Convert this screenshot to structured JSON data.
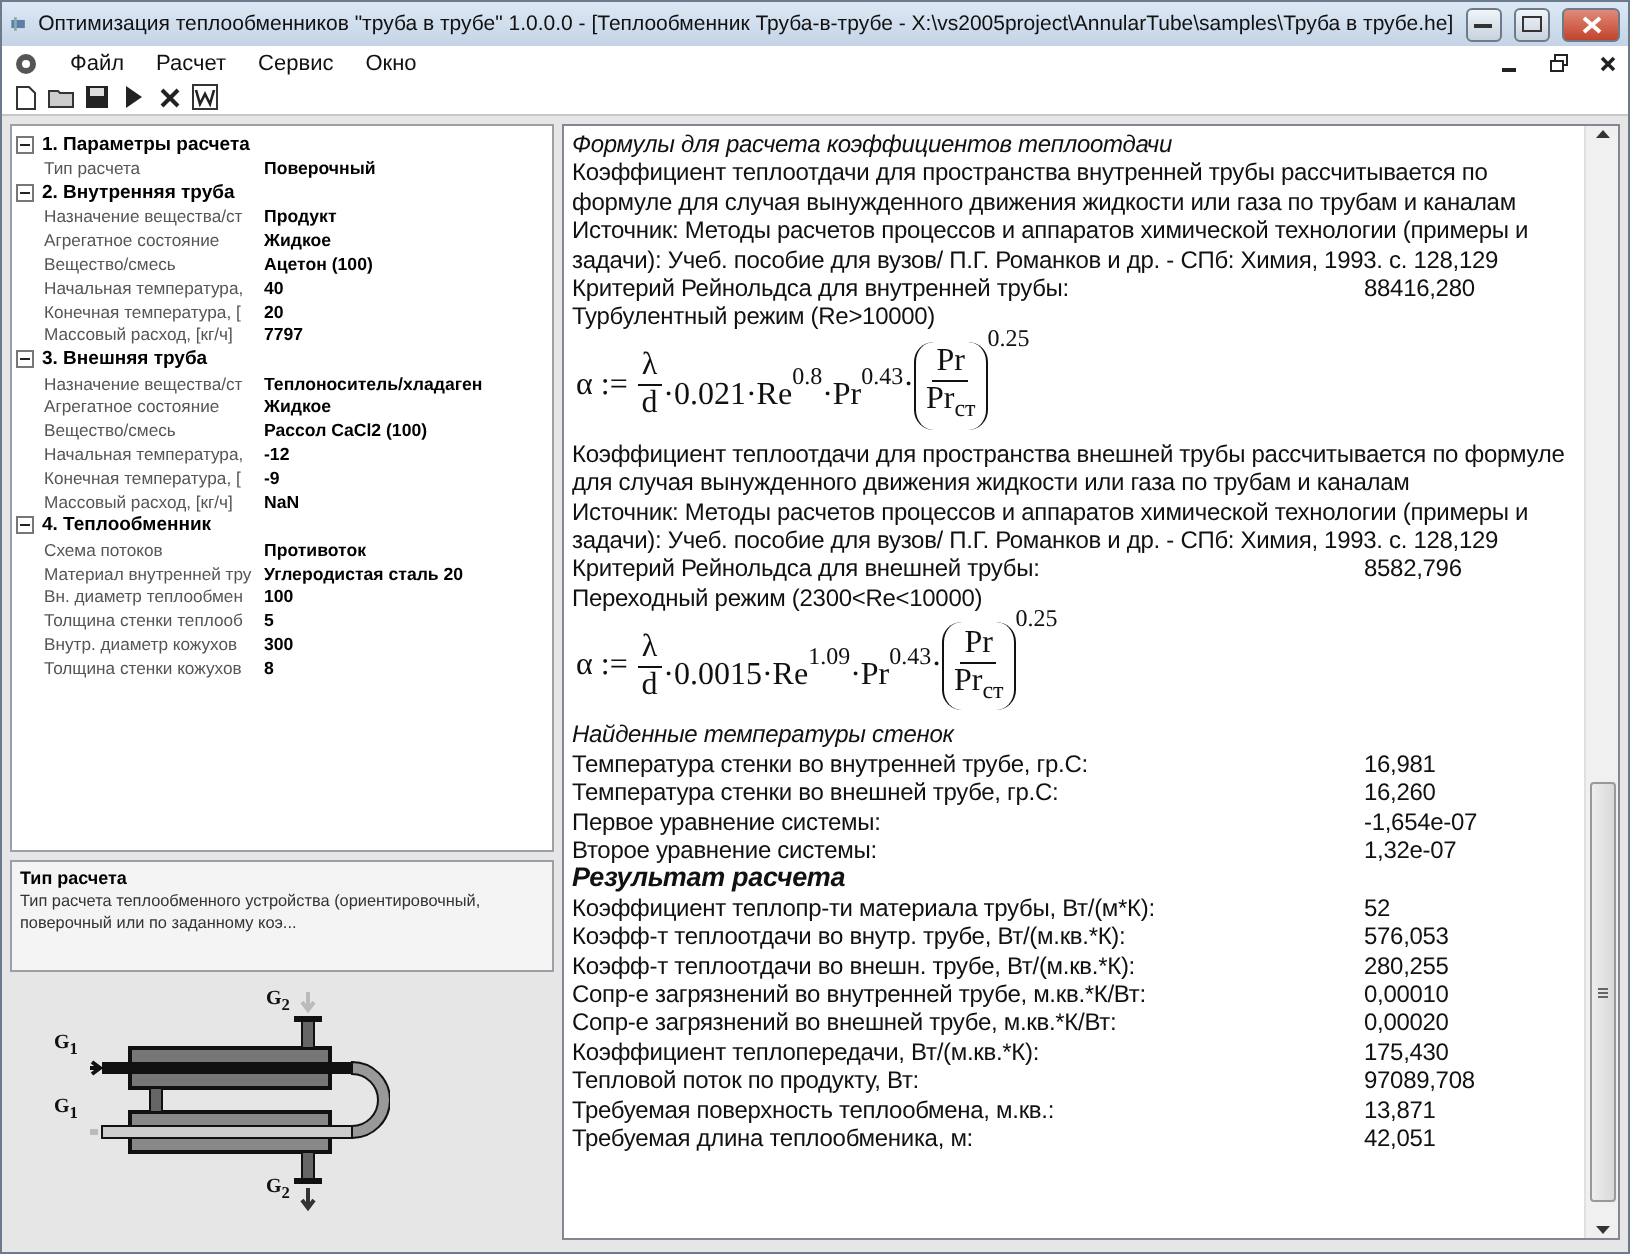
{
  "window": {
    "title": "Оптимизация теплообменников \"труба в трубе\" 1.0.0.0 - [Теплообменник Труба-в-трубе - X:\\vs2005project\\AnnularTube\\samples\\Труба в трубе.he]"
  },
  "menu": [
    "Файл",
    "Расчет",
    "Сервис",
    "Окно"
  ],
  "properties": [
    {
      "title": "1. Параметры расчета",
      "expanded": true,
      "rows": [
        {
          "name": "Тип расчета",
          "value": "Поверочный"
        }
      ]
    },
    {
      "title": "2. Внутренняя труба",
      "expanded": true,
      "rows": [
        {
          "name": "Назначение вещества/ст",
          "value": "Продукт"
        },
        {
          "name": "Агрегатное состояние",
          "value": "Жидкое"
        },
        {
          "name": "Вещество/смесь",
          "value": "Ацетон (100)"
        },
        {
          "name": "Начальная температура,",
          "value": "40"
        },
        {
          "name": "Конечная температура, [",
          "value": "20"
        },
        {
          "name": "Массовый расход, [кг/ч]",
          "value": "7797"
        }
      ]
    },
    {
      "title": "3. Внешняя труба",
      "expanded": true,
      "rows": [
        {
          "name": "Назначение вещества/ст",
          "value": "Теплоноситель/хладаген"
        },
        {
          "name": "Агрегатное состояние",
          "value": "Жидкое"
        },
        {
          "name": "Вещество/смесь",
          "value": "Рассол CaCl2 (100)"
        },
        {
          "name": "Начальная температура,",
          "value": "-12"
        },
        {
          "name": "Конечная температура, [",
          "value": "-9"
        },
        {
          "name": "Массовый расход, [кг/ч]",
          "value": "NaN"
        }
      ]
    },
    {
      "title": "4. Теплообменник",
      "expanded": true,
      "rows": [
        {
          "name": "Схема потоков",
          "value": "Противоток"
        },
        {
          "name": "Материал внутренней тру",
          "value": "Углеродистая сталь 20"
        },
        {
          "name": "Вн. диаметр теплообмен",
          "value": "100"
        },
        {
          "name": "Толщина стенки теплооб",
          "value": "5"
        },
        {
          "name": "Внутр. диаметр кожухов",
          "value": "300"
        },
        {
          "name": "Толщина стенки кожухов",
          "value": "8"
        }
      ]
    }
  ],
  "description": {
    "title": "Тип расчета",
    "text": "Тип расчета теплообменного устройства (ориентировочный, поверочный или по заданному коэ..."
  },
  "diagram": {
    "labels": [
      "G$_{2}$",
      "G$_{1}$",
      "G$_{1}$",
      "G$_{2}$"
    ]
  },
  "report": [
    {
      "kind": "heading",
      "text": "Формулы для расчета коэффициентов теплоотдачи"
    },
    {
      "kind": "text",
      "text": "Коэффициент теплоотдачи для пространства внутренней трубы рассчитывается по формуле для случая вынужденного движения жидкости или газа по трубам и каналам"
    },
    {
      "kind": "text",
      "text": "Источник: Методы расчетов процессов и аппаратов химической технологии (примеры и задачи): Учеб. пособие для вузов/ П.Г. Романков и др. - СПб: Химия, 1993.  с. 128,129"
    },
    {
      "kind": "value",
      "text": "Критерий Рейнольдса для внутренней трубы:",
      "value": "88416,280"
    },
    {
      "kind": "text",
      "text": "Турбулентный режим (Re>10000)"
    },
    {
      "kind": "formula",
      "lhs": "α",
      "assign": ":=",
      "num": "λ",
      "den": "d",
      "terms": [
        {
          "base": "·0.021·Re",
          "exp": "0.8"
        },
        {
          "base": "·Pr",
          "exp": "0.43"
        }
      ],
      "dot": "·",
      "ratio_num": "Pr",
      "ratio_den": "Pr",
      "ratio_sub": "ст",
      "power": "0.25"
    },
    {
      "kind": "text",
      "text": "Коэффициент теплоотдачи для пространства внешней трубы рассчитывается по формуле для случая вынужденного движения жидкости или газа по трубам и каналам"
    },
    {
      "kind": "text",
      "text": "Источник: Методы расчетов процессов и аппаратов химической технологии (примеры и задачи): Учеб. пособие для вузов/ П.Г. Романков и др. - СПб: Химия, 1993.  с. 128,129"
    },
    {
      "kind": "value",
      "text": "Критерий Рейнольдса для внешней трубы:",
      "value": "8582,796"
    },
    {
      "kind": "text",
      "text": "Переходный режим (2300<Re<10000)"
    },
    {
      "kind": "formula",
      "lhs": "α",
      "assign": ":=",
      "num": "λ",
      "den": "d",
      "terms": [
        {
          "base": "·0.0015·Re",
          "exp": "1.09"
        },
        {
          "base": "·Pr",
          "exp": "0.43"
        }
      ],
      "dot": "·",
      "ratio_num": "Pr",
      "ratio_den": "Pr",
      "ratio_sub": "ст",
      "power": "0.25"
    },
    {
      "kind": "heading",
      "text": "Найденные температуры стенок"
    },
    {
      "kind": "value",
      "text": "Температура стенки во внутренней трубе, гр.С:",
      "value": "16,981"
    },
    {
      "kind": "value",
      "text": "Температура стенки во внешней трубе, гр.С:",
      "value": "16,260"
    },
    {
      "kind": "value",
      "text": "Первое уравнение системы:",
      "value": "-1,654e-07"
    },
    {
      "kind": "value",
      "text": "Второе уравнение системы:",
      "value": "1,32e-07"
    },
    {
      "kind": "result",
      "text": "Результат расчета"
    },
    {
      "kind": "value",
      "text": "Коэффициент теплопр-ти материала трубы, Вт/(м*К):",
      "value": "52"
    },
    {
      "kind": "value",
      "text": "Коэфф-т теплоотдачи во внутр. трубе, Вт/(м.кв.*К):",
      "value": "576,053"
    },
    {
      "kind": "value",
      "text": "Коэфф-т теплоотдачи во внешн. трубе, Вт/(м.кв.*К):",
      "value": "280,255"
    },
    {
      "kind": "value",
      "text": "Сопр-е загрязнений во внутренней трубе, м.кв.*К/Вт:",
      "value": "0,00010"
    },
    {
      "kind": "value",
      "text": "Сопр-е загрязнений во внешней трубе, м.кв.*К/Вт:",
      "value": "0,00020"
    },
    {
      "kind": "value",
      "text": "Коэффициент теплопередачи, Вт/(м.кв.*К):",
      "value": "175,430"
    },
    {
      "kind": "value",
      "text": "Тепловой поток по продукту, Вт:",
      "value": "97089,708"
    },
    {
      "kind": "value",
      "text": "Требуемая поверхность теплообмена, м.кв.:",
      "value": "13,871"
    },
    {
      "kind": "value",
      "text": "Требуемая длина теплообменика, м:",
      "value": "42,051"
    }
  ]
}
